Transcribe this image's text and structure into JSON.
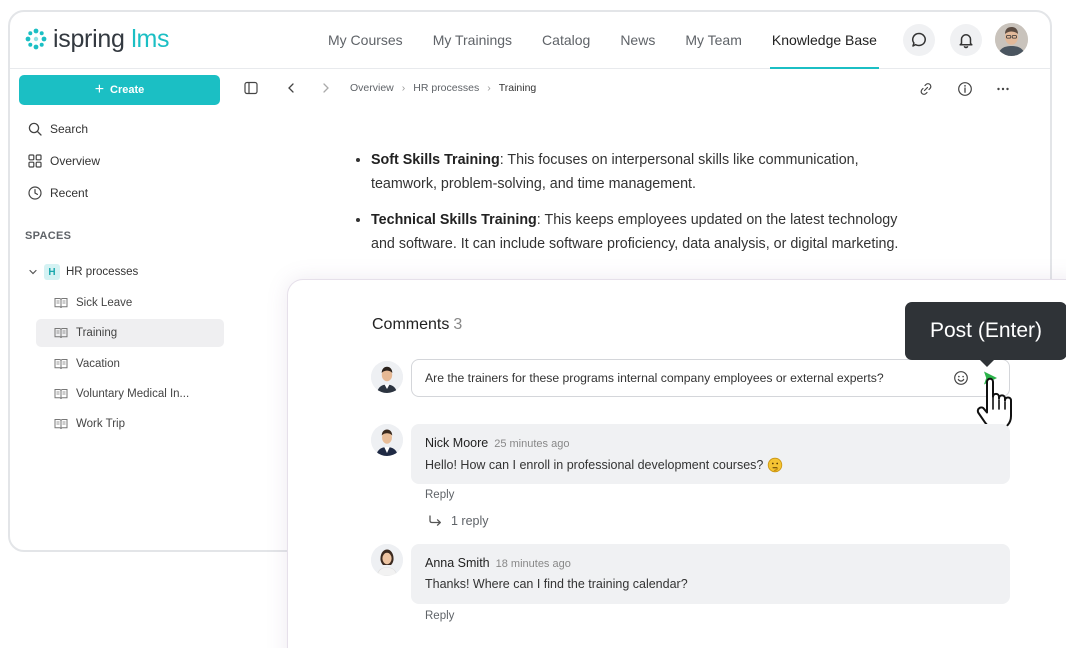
{
  "app": {
    "logo": {
      "part1": "ispring",
      "part2": "lms"
    },
    "nav": [
      "My Courses",
      "My Trainings",
      "Catalog",
      "News",
      "My Team",
      "Knowledge Base"
    ],
    "active_nav": "Knowledge Base"
  },
  "sidebar": {
    "create_label": "Create",
    "search_label": "Search",
    "overview_label": "Overview",
    "recent_label": "Recent",
    "spaces_title": "SPACES",
    "space": {
      "badge": "H",
      "name": "HR processes"
    },
    "items": [
      "Sick Leave",
      "Training",
      "Vacation",
      "Voluntary Medical In...",
      "Work Trip"
    ],
    "selected_item": "Training"
  },
  "breadcrumb": [
    "Overview",
    "HR processes",
    "Training"
  ],
  "article": {
    "bullets": [
      {
        "title": "Soft Skills Training",
        "text": ": This focuses on interpersonal skills like communication, teamwork, problem-solving, and time management."
      },
      {
        "title": "Technical Skills Training",
        "text": ": This keeps employees updated on the latest technology and software. It can include software proficiency, data analysis, or digital marketing."
      }
    ]
  },
  "comments": {
    "title": "Comments",
    "count": "3",
    "draft": "Are the trainers for these programs internal company employees or external experts?",
    "tooltip": "Post (Enter)",
    "list": [
      {
        "author": "Nick Moore",
        "time": "25 minutes ago",
        "text": "Hello! How can I enroll in professional development courses?",
        "reply_label": "Reply",
        "replies": "1 reply"
      },
      {
        "author": "Anna Smith",
        "time": "18 minutes ago",
        "text": "Thanks! Where can I find the training calendar?",
        "reply_label": "Reply"
      }
    ]
  },
  "colors": {
    "accent": "#1bbfc4",
    "send": "#2bb34a",
    "tooltip_bg": "#2f3337",
    "bubble_bg": "#f0f1f3"
  }
}
